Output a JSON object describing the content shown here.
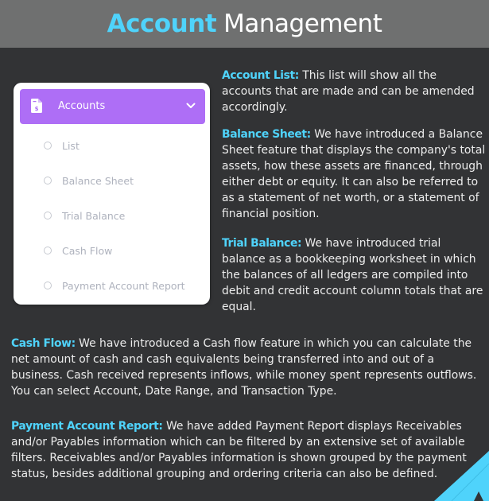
{
  "header": {
    "title_accent": "Account",
    "title_rest": "Management"
  },
  "menu": {
    "icon": "document-dollar-icon",
    "label": "Accounts",
    "expand_icon": "chevron-down-icon",
    "accent_color": "#ae6ef6",
    "items": [
      {
        "label": "List"
      },
      {
        "label": "Balance Sheet"
      },
      {
        "label": "Trial Balance"
      },
      {
        "label": "Cash Flow"
      },
      {
        "label": "Payment Account Report"
      }
    ]
  },
  "sections": {
    "account_list": {
      "key": "Account List:",
      "text": " This list will show all the accounts that are made and can be amended accordingly."
    },
    "balance_sheet": {
      "key": "Balance Sheet:",
      "text": " We have introduced a Balance Sheet feature that displays the company's total assets, how these assets are financed, through either debt or equity. It can also be referred to as a statement of net worth, or a statement of financial position."
    },
    "trial_balance": {
      "key": "Trial Balance:",
      "text": " We have introduced trial balance as a bookkeeping worksheet in which the balances of all ledgers are compiled into debit and credit account column totals that are equal."
    },
    "cash_flow": {
      "key": "Cash Flow:",
      "text": " We have introduced a Cash flow feature in which you can calculate the net amount of cash and cash equivalents being transferred into and out of a business. Cash received represents inflows, while money spent represents outflows. You can select  Account, Date Range, and Transaction Type."
    },
    "payment_report": {
      "key": "Payment Account Report:",
      "text": " We have added Payment Report displays Receivables and/or Payables information which can be filtered by an extensive set of available filters. Receivables and/or Payables information is shown grouped by the payment status, besides additional grouping and ordering criteria can also be defined."
    }
  },
  "colors": {
    "accent": "#4fd3fb",
    "background": "#323335",
    "header_bg": "#6f7070"
  }
}
